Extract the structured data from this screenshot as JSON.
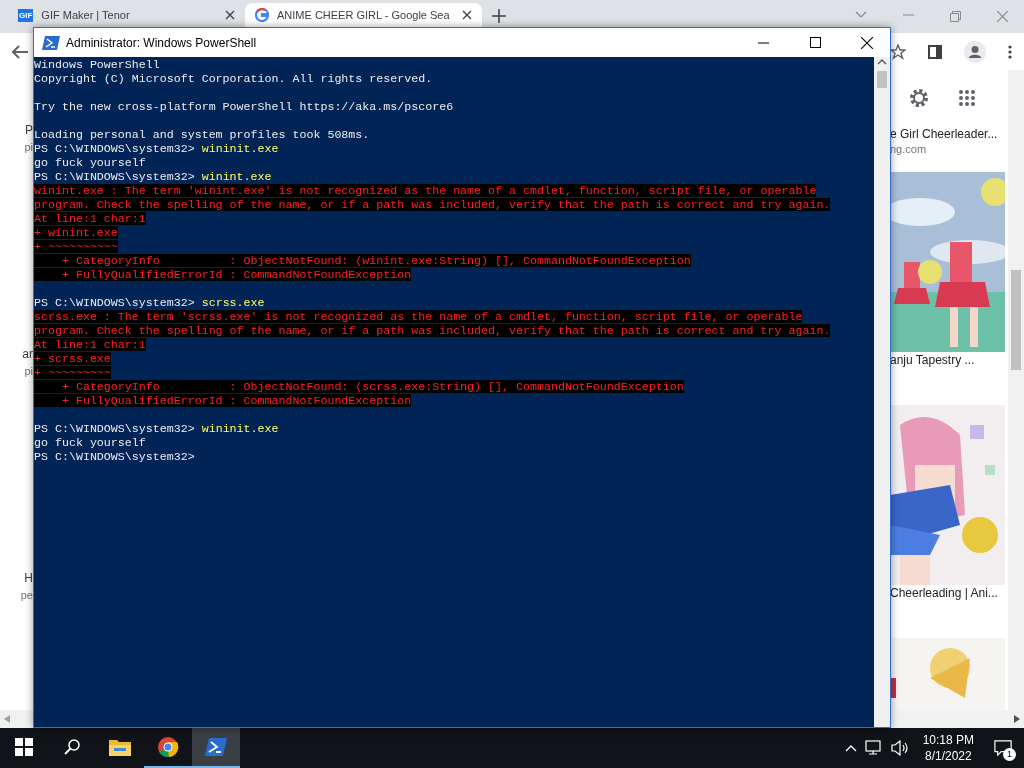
{
  "browser": {
    "tabs": [
      {
        "title": "GIF Maker | Tenor",
        "favicon_text": "GIF",
        "selected": false
      },
      {
        "title": "ANIME CHEER GIRL - Google Sea",
        "selected": true
      }
    ],
    "left_fragments": [
      "P",
      "pi",
      "ar",
      "pi",
      "H",
      "pe"
    ],
    "results": [
      {
        "title": "e Girl Cheerleader...",
        "source": "ng.com"
      },
      {
        "kind": "picture"
      },
      {
        "title": "anju Tapestry ..."
      },
      {
        "kind": "picture"
      },
      {
        "title": "Cheerleading | Ani..."
      },
      {
        "kind": "picture"
      }
    ]
  },
  "window": {
    "title": "Administrator: Windows PowerShell",
    "lines": [
      {
        "kind": "output",
        "text": "Windows PowerShell"
      },
      {
        "kind": "output",
        "text": "Copyright (C) Microsoft Corporation. All rights reserved."
      },
      {
        "kind": "blank"
      },
      {
        "kind": "output",
        "text": "Try the new cross-platform PowerShell https://aka.ms/pscore6"
      },
      {
        "kind": "blank"
      },
      {
        "kind": "output",
        "text": "Loading personal and system profiles took 508ms."
      },
      {
        "kind": "command",
        "prompt": "PS C:\\WINDOWS\\system32>",
        "command": "wininit.exe"
      },
      {
        "kind": "output",
        "text": "go fuck yourself"
      },
      {
        "kind": "command",
        "prompt": "PS C:\\WINDOWS\\system32>",
        "command": "winint.exe"
      },
      {
        "kind": "error",
        "text": "winint.exe : The term 'winint.exe' is not recognized as the name of a cmdlet, function, script file, or operable"
      },
      {
        "kind": "error",
        "text": "program. Check the spelling of the name, or if a path was included, verify that the path is correct and try again."
      },
      {
        "kind": "error",
        "text": "At line:1 char:1"
      },
      {
        "kind": "error",
        "text": "+ winint.exe"
      },
      {
        "kind": "error",
        "text": "+ ~~~~~~~~~~"
      },
      {
        "kind": "error",
        "text": "    + CategoryInfo          : ObjectNotFound: (winint.exe:String) [], CommandNotFoundException"
      },
      {
        "kind": "error",
        "text": "    + FullyQualifiedErrorId : CommandNotFoundException"
      },
      {
        "kind": "blank"
      },
      {
        "kind": "command",
        "prompt": "PS C:\\WINDOWS\\system32>",
        "command": "scrss.exe"
      },
      {
        "kind": "error",
        "text": "scrss.exe : The term 'scrss.exe' is not recognized as the name of a cmdlet, function, script file, or operable"
      },
      {
        "kind": "error",
        "text": "program. Check the spelling of the name, or if a path was included, verify that the path is correct and try again."
      },
      {
        "kind": "error",
        "text": "At line:1 char:1"
      },
      {
        "kind": "error",
        "text": "+ scrss.exe"
      },
      {
        "kind": "error",
        "text": "+ ~~~~~~~~~"
      },
      {
        "kind": "error",
        "text": "    + CategoryInfo          : ObjectNotFound: (scrss.exe:String) [], CommandNotFoundException"
      },
      {
        "kind": "error",
        "text": "    + FullyQualifiedErrorId : CommandNotFoundException"
      },
      {
        "kind": "blank"
      },
      {
        "kind": "command",
        "prompt": "PS C:\\WINDOWS\\system32>",
        "command": "wininit.exe"
      },
      {
        "kind": "output",
        "text": "go fuck yourself"
      },
      {
        "kind": "command",
        "prompt": "PS C:\\WINDOWS\\system32>"
      }
    ]
  },
  "taskbar": {
    "apps": [
      {
        "kind": "start"
      },
      {
        "kind": "search"
      },
      {
        "kind": "explorer",
        "running": false,
        "selected": false
      },
      {
        "kind": "chrome",
        "running": true,
        "selected": false
      },
      {
        "kind": "powershell",
        "running": true,
        "selected": true
      }
    ],
    "time": "10:18 PM",
    "date": "8/1/2022",
    "notifications": "1"
  }
}
